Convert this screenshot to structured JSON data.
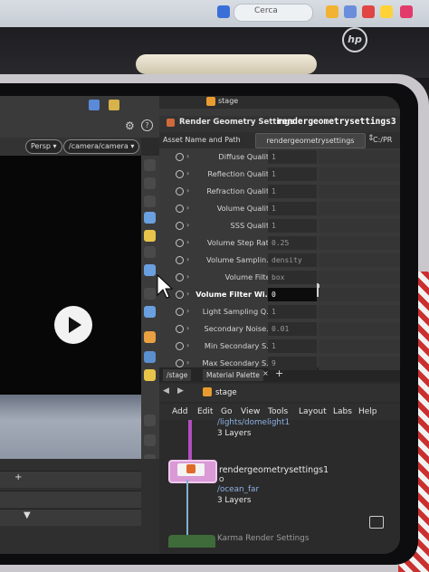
{
  "taskbar": {
    "search_label": "Cerca"
  },
  "laptop": {
    "brand": "hp"
  },
  "viewer": {
    "camera_menu": "Persp ▾",
    "camera_path": "/camera/camera ▾"
  },
  "parameters": {
    "title": "Render Geometry Settings",
    "node_name": "rendergeometrysettings3",
    "asset_label": "Asset Name and Path",
    "asset_value": "rendergeometrysettings",
    "asset_path": "C:/PR",
    "context_label": "stage",
    "rows": [
      {
        "label": "Diffuse Quality",
        "value": "1"
      },
      {
        "label": "Reflection Quality",
        "value": "1"
      },
      {
        "label": "Refraction Quality",
        "value": "1"
      },
      {
        "label": "Volume Quality",
        "value": "1"
      },
      {
        "label": "SSS Quality",
        "value": "1"
      },
      {
        "label": "Volume Step Rate",
        "value": "0.25"
      },
      {
        "label": "Volume Samplin...",
        "value": "density"
      },
      {
        "label": "Volume Filter",
        "value": "box"
      },
      {
        "label": "Volume Filter Wi...",
        "value": "0"
      },
      {
        "label": "Light Sampling Q...",
        "value": "1"
      },
      {
        "label": "Secondary Noise...",
        "value": "0.01"
      },
      {
        "label": "Min Secondary S...",
        "value": "1"
      },
      {
        "label": "Max Secondary S...",
        "value": "9"
      }
    ]
  },
  "network": {
    "tabs": [
      "/stage",
      "Material Palette"
    ],
    "context_label": "stage",
    "menu": [
      "Add",
      "Edit",
      "Go",
      "View",
      "Tools",
      "Layout",
      "Labs",
      "Help"
    ],
    "top_node_path": "/lights/domelight1",
    "top_node_layers": "3 Layers",
    "node_name": "rendergeometrysettings1",
    "node_marker": "O",
    "node_path": "/ocean_far",
    "node_layers": "3 Layers",
    "bottom_node_label": "Karma Render Settings"
  }
}
